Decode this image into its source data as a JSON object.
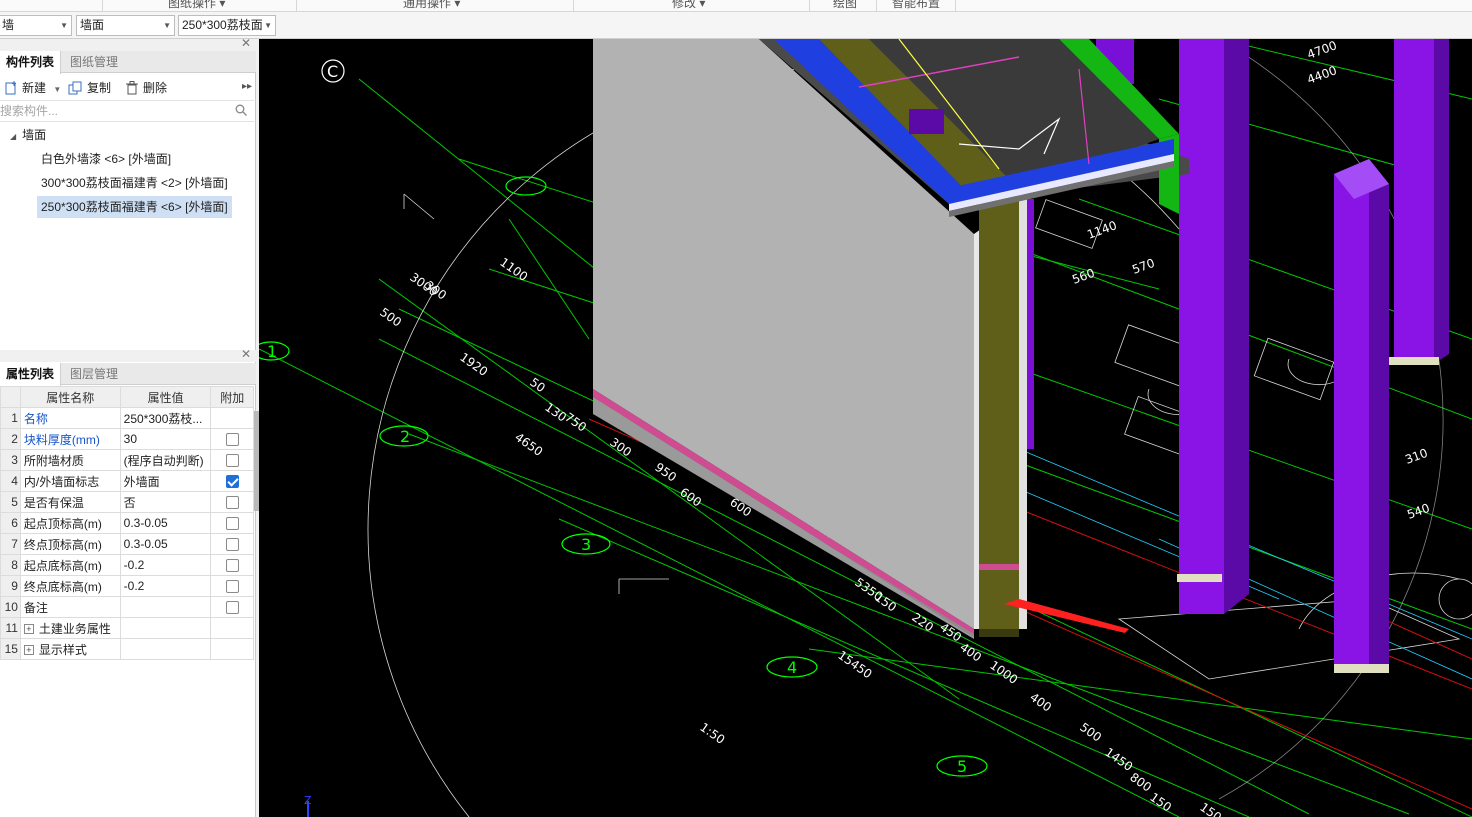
{
  "ribbon": {
    "groups": [
      "图纸操作 ▾",
      "通用操作 ▾",
      "修改 ▾",
      "绘图",
      "智能布置"
    ]
  },
  "selectors": {
    "first": "墙",
    "second": "墙面",
    "third": "250*300荔枝面"
  },
  "component_panel": {
    "tabs": [
      "构件列表",
      "图纸管理"
    ],
    "toolbar": {
      "new": "新建",
      "copy": "复制",
      "delete": "删除"
    },
    "search_placeholder": "搜索构件...",
    "tree_root": "墙面",
    "items": [
      "白色外墙漆 <6> [外墙面]",
      "300*300荔枝面福建青 <2> [外墙面]",
      "250*300荔枝面福建青 <6> [外墙面]"
    ]
  },
  "property_panel": {
    "tabs": [
      "属性列表",
      "图层管理"
    ],
    "headers": [
      "属性名称",
      "属性值",
      "附加"
    ],
    "rows": [
      {
        "num": "1",
        "name": "名称",
        "value": "250*300荔枝...",
        "check": null,
        "blue": true
      },
      {
        "num": "2",
        "name": "块料厚度(mm)",
        "value": "30",
        "check": false,
        "blue": true
      },
      {
        "num": "3",
        "name": "所附墙材质",
        "value": "(程序自动判断)",
        "check": false,
        "blue": false
      },
      {
        "num": "4",
        "name": "内/外墙面标志",
        "value": "外墙面",
        "check": true,
        "blue": false
      },
      {
        "num": "5",
        "name": "是否有保温",
        "value": "否",
        "check": false,
        "blue": false
      },
      {
        "num": "6",
        "name": "起点顶标高(m)",
        "value": "0.3-0.05",
        "check": false,
        "blue": false
      },
      {
        "num": "7",
        "name": "终点顶标高(m)",
        "value": "0.3-0.05",
        "check": false,
        "blue": false
      },
      {
        "num": "8",
        "name": "起点底标高(m)",
        "value": "-0.2",
        "check": false,
        "blue": false
      },
      {
        "num": "9",
        "name": "终点底标高(m)",
        "value": "-0.2",
        "check": false,
        "blue": false
      },
      {
        "num": "10",
        "name": "备注",
        "value": "",
        "check": false,
        "blue": false
      },
      {
        "num": "11",
        "name": "土建业务属性",
        "value": "",
        "check": null,
        "blue": false,
        "expand": true
      },
      {
        "num": "15",
        "name": "显示样式",
        "value": "",
        "check": null,
        "blue": false,
        "expand": true
      }
    ]
  },
  "viewport": {
    "axis_circles": [
      "C",
      "1",
      "2",
      "3",
      "4",
      "5"
    ],
    "dims": [
      "500",
      "1920",
      "50",
      "130",
      "750",
      "4650",
      "300",
      "950",
      "600",
      "600",
      "950",
      "300",
      "800",
      "5350",
      "150",
      "220",
      "450",
      "400",
      "1000",
      "15450",
      "400",
      "500",
      "1450",
      "800",
      "150",
      "150",
      "1:50",
      "3000",
      "300",
      "1100",
      "4700",
      "4400",
      "1140",
      "570",
      "560",
      "540",
      "310"
    ],
    "z_label": "Z",
    "colors": {
      "wall": "#b2b2b2",
      "purple": "#8a14e6",
      "green": "#00ff00",
      "blue": "#1f3fe0",
      "olive": "#5f5f1a",
      "pink": "#e0408f",
      "red": "#ff2020"
    }
  }
}
